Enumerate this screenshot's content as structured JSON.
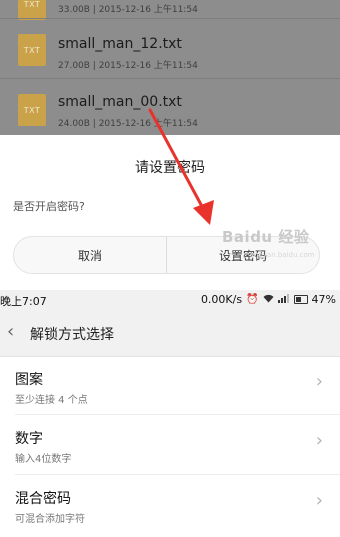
{
  "file_list": {
    "items": [
      {
        "icon_text": "TXT",
        "name": "",
        "meta": "33.00B | 2015-12-16 上午11:54"
      },
      {
        "icon_text": "TXT",
        "name": "small_man_12.txt",
        "meta": "27.00B | 2015-12-16 上午11:54"
      },
      {
        "icon_text": "TXT",
        "name": "small_man_00.txt",
        "meta": "24.00B | 2015-12-16 上午11:54"
      }
    ]
  },
  "dialog": {
    "title": "请设置密码",
    "message": "是否开启密码?",
    "cancel_label": "取消",
    "confirm_label": "设置密码"
  },
  "annotation": {
    "arrow_color": "#e8322b"
  },
  "watermark": {
    "text": "Baidu 经验",
    "sub": "jingyan.baidu.com"
  },
  "status_bar": {
    "time": "晚上7:07",
    "speed": "0.00K/s",
    "battery": "47%"
  },
  "nav": {
    "title": "解锁方式选择"
  },
  "options": [
    {
      "title": "图案",
      "subtitle": "至少连接 4 个点"
    },
    {
      "title": "数字",
      "subtitle": "输入4位数字"
    },
    {
      "title": "混合密码",
      "subtitle": "可混合添加字符"
    }
  ]
}
